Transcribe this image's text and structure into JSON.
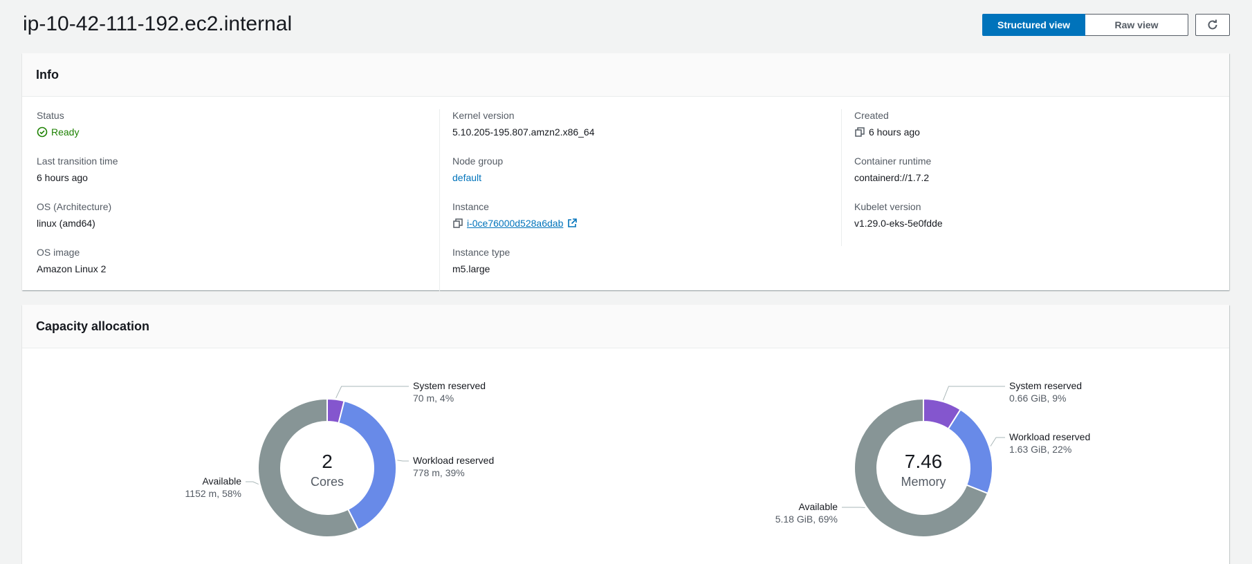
{
  "page": {
    "title": "ip-10-42-111-192.ec2.internal",
    "views": {
      "structured": "Structured view",
      "raw": "Raw view"
    }
  },
  "info": {
    "title": "Info",
    "columns": [
      [
        {
          "label": "Status",
          "value": "Ready",
          "kind": "status"
        },
        {
          "label": "Last transition time",
          "value": "6 hours ago"
        },
        {
          "label": "OS (Architecture)",
          "value": "linux (amd64)"
        },
        {
          "label": "OS image",
          "value": "Amazon Linux 2"
        }
      ],
      [
        {
          "label": "Kernel version",
          "value": "5.10.205-195.807.amzn2.x86_64"
        },
        {
          "label": "Node group",
          "value": "default",
          "kind": "link"
        },
        {
          "label": "Instance",
          "value": "i-0ce76000d528a6dab",
          "kind": "instance"
        },
        {
          "label": "Instance type",
          "value": "m5.large"
        }
      ],
      [
        {
          "label": "Created",
          "value": "6 hours ago",
          "kind": "copy"
        },
        {
          "label": "Container runtime",
          "value": "containerd://1.7.2"
        },
        {
          "label": "Kubelet version",
          "value": "v1.29.0-eks-5e0fdde"
        }
      ]
    ]
  },
  "capacity": {
    "title": "Capacity allocation",
    "colors": {
      "system": "#8456ce",
      "workload": "#688ae8",
      "available": "#879596"
    },
    "chart_data": [
      {
        "type": "pie",
        "center_value": "2",
        "center_label": "Cores",
        "slices": [
          {
            "name": "System reserved",
            "detail": "70 m, 4%",
            "value": 4,
            "color_key": "system"
          },
          {
            "name": "Workload reserved",
            "detail": "778 m, 39%",
            "value": 39,
            "color_key": "workload"
          },
          {
            "name": "Available",
            "detail": "1152 m, 58%",
            "value": 58,
            "color_key": "available"
          }
        ]
      },
      {
        "type": "pie",
        "center_value": "7.46",
        "center_label": "Memory",
        "slices": [
          {
            "name": "System reserved",
            "detail": "0.66 GiB, 9%",
            "value": 9,
            "color_key": "system"
          },
          {
            "name": "Workload reserved",
            "detail": "1.63 GiB, 22%",
            "value": 22,
            "color_key": "workload"
          },
          {
            "name": "Available",
            "detail": "5.18 GiB, 69%",
            "value": 69,
            "color_key": "available"
          }
        ]
      }
    ]
  }
}
